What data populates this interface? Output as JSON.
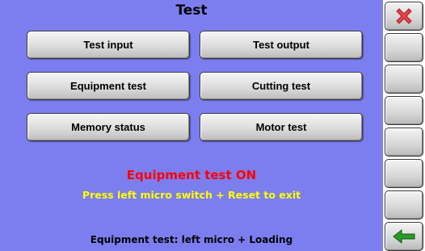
{
  "header": {
    "title": "Test"
  },
  "buttons": {
    "test_input": "Test input",
    "test_output": "Test output",
    "equipment_test": "Equipment test",
    "cutting_test": "Cutting test",
    "memory_status": "Memory status",
    "motor_test": "Motor test"
  },
  "status": {
    "mode": "Equipment test ON",
    "exit_hint": "Press left micro switch + Reset to exit"
  },
  "footer": {
    "text": "Equipment test: left micro + Loading"
  },
  "side_panel": {
    "icons": [
      "close-icon",
      "back-arrow-icon"
    ]
  },
  "colors": {
    "background": "#7c7ef0",
    "status_on": "#ff0000",
    "exit_hint": "#ffff00",
    "close_icon": "#e8434a",
    "back_arrow": "#2a9a2a"
  }
}
